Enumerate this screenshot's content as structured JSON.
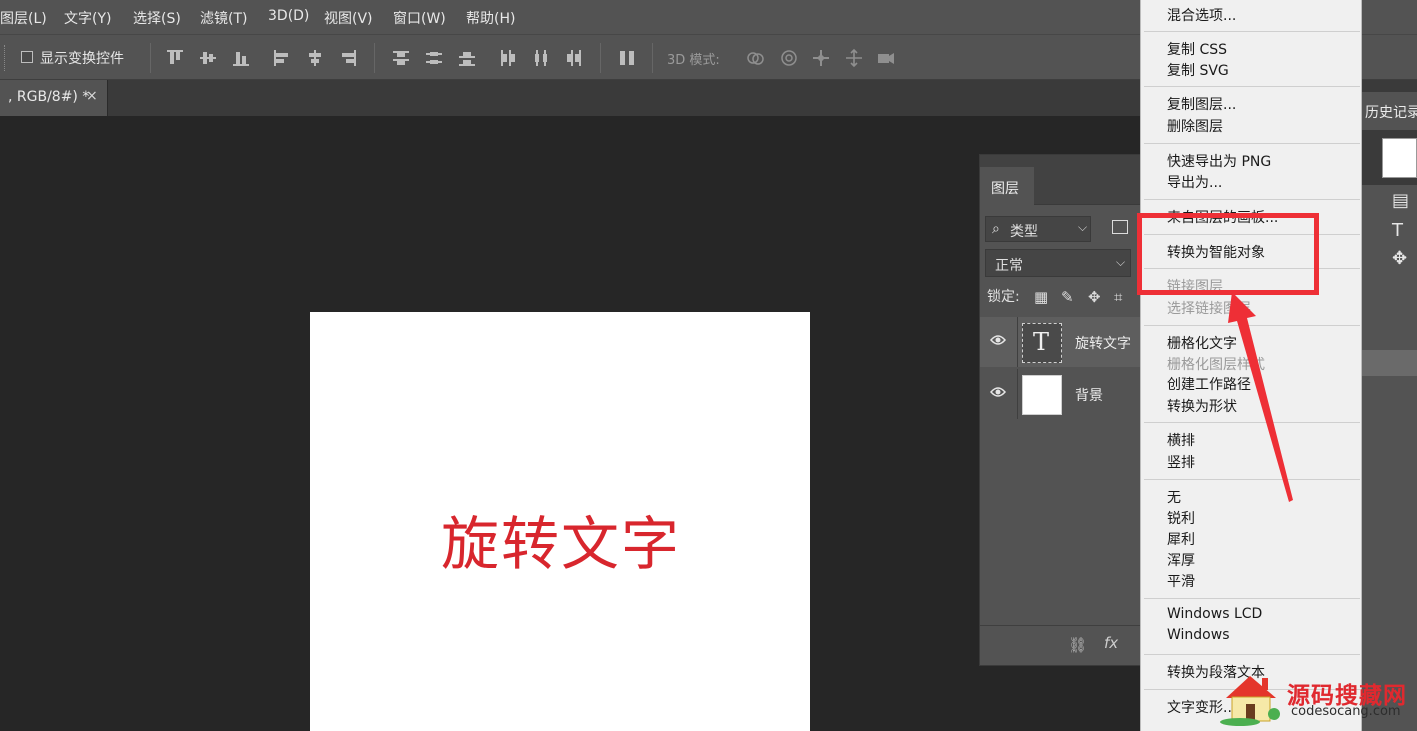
{
  "menubar": {
    "items": [
      "图层(L)",
      "文字(Y)",
      "选择(S)",
      "滤镜(T)",
      "3D(D)",
      "视图(V)",
      "窗口(W)",
      "帮助(H)"
    ]
  },
  "options_bar": {
    "show_transform_controls": "显示变换控件",
    "show_transform_checked": false,
    "mode_3d_label": "3D 模式:"
  },
  "document_tab": {
    "title": ", RGB/8#) *",
    "close": "×"
  },
  "canvas": {
    "text": "旋转文字",
    "text_color": "#d8262d",
    "background": "#ffffff"
  },
  "layers_panel": {
    "tab_label": "图层",
    "filter_kind": "类型",
    "blend_mode": "正常",
    "lock_label": "锁定:",
    "layers": [
      {
        "name": "旋转文字",
        "type": "text",
        "thumb_glyph": "T",
        "visible": true,
        "selected": true
      },
      {
        "name": "背景",
        "type": "background",
        "visible": true,
        "selected": false
      }
    ],
    "footer_fx": "fx"
  },
  "history_panel": {
    "tab_label": "历史记录"
  },
  "context_menu": {
    "items": [
      {
        "label": "混合选项...",
        "disabled": false
      },
      {
        "label": "复制 CSS",
        "disabled": false
      },
      {
        "label": "复制 SVG",
        "disabled": false
      },
      {
        "label": "复制图层...",
        "disabled": false
      },
      {
        "label": "删除图层",
        "disabled": false
      },
      {
        "label": "快速导出为 PNG",
        "disabled": false
      },
      {
        "label": "导出为...",
        "disabled": false
      },
      {
        "label": "来自图层的画板...",
        "disabled": false
      },
      {
        "label": "转换为智能对象",
        "disabled": false,
        "highlighted": true
      },
      {
        "label": "链接图层",
        "disabled": true
      },
      {
        "label": "选择链接图层",
        "disabled": true
      },
      {
        "label": "栅格化文字",
        "disabled": false
      },
      {
        "label": "栅格化图层样式",
        "disabled": true
      },
      {
        "label": "创建工作路径",
        "disabled": false
      },
      {
        "label": "转换为形状",
        "disabled": false
      },
      {
        "label": "横排",
        "disabled": false
      },
      {
        "label": "竖排",
        "disabled": false
      },
      {
        "label": "无",
        "disabled": false
      },
      {
        "label": "锐利",
        "disabled": false
      },
      {
        "label": "犀利",
        "disabled": false
      },
      {
        "label": "浑厚",
        "disabled": false
      },
      {
        "label": "平滑",
        "disabled": false
      },
      {
        "label": "Windows LCD",
        "disabled": false
      },
      {
        "label": "Windows",
        "disabled": false
      },
      {
        "label": "转换为段落文本",
        "disabled": false
      },
      {
        "label": "文字变形...",
        "disabled": false
      }
    ]
  },
  "annotation": {
    "color": "#ee2f36",
    "target": "转换为智能对象"
  },
  "watermark": {
    "cn": "源码搜藏网",
    "en": "codesocang.com"
  }
}
